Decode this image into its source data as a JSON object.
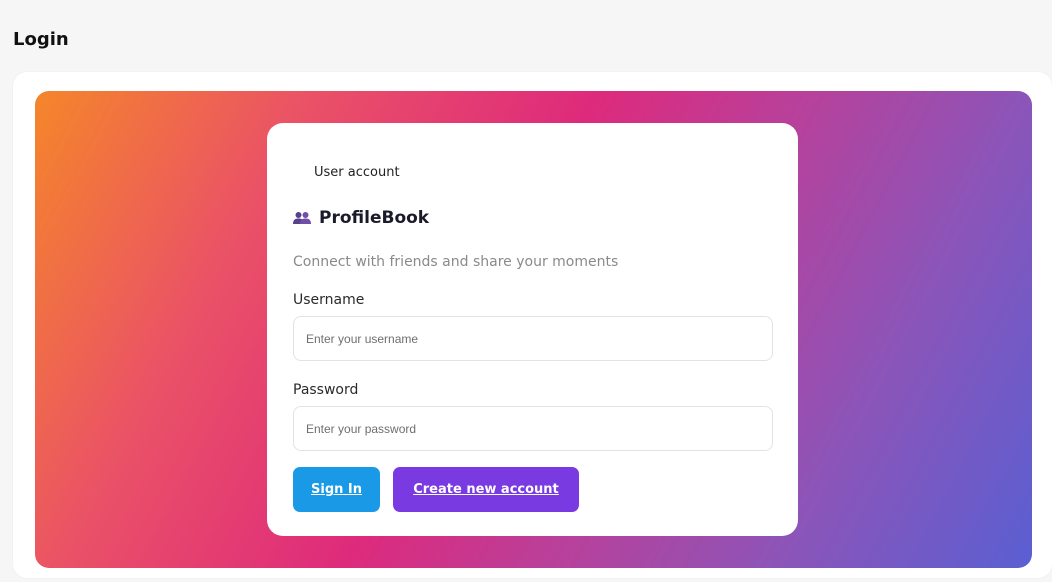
{
  "page": {
    "title": "Login"
  },
  "card": {
    "header": "User account",
    "brand_icon": "people-icon",
    "brand_name": "ProfileBook",
    "tagline": "Connect with friends and share your moments"
  },
  "form": {
    "username_label": "Username",
    "username_placeholder": "Enter your username",
    "username_value": "",
    "password_label": "Password",
    "password_placeholder": "Enter your password",
    "password_value": "",
    "signin_label": "Sign In",
    "create_label": "Create new account"
  },
  "colors": {
    "signin_button": "#1a9ae6",
    "create_button": "#7a3ae2",
    "gradient": [
      "#f5862a",
      "#de2a7c",
      "#5a5fd2"
    ]
  }
}
